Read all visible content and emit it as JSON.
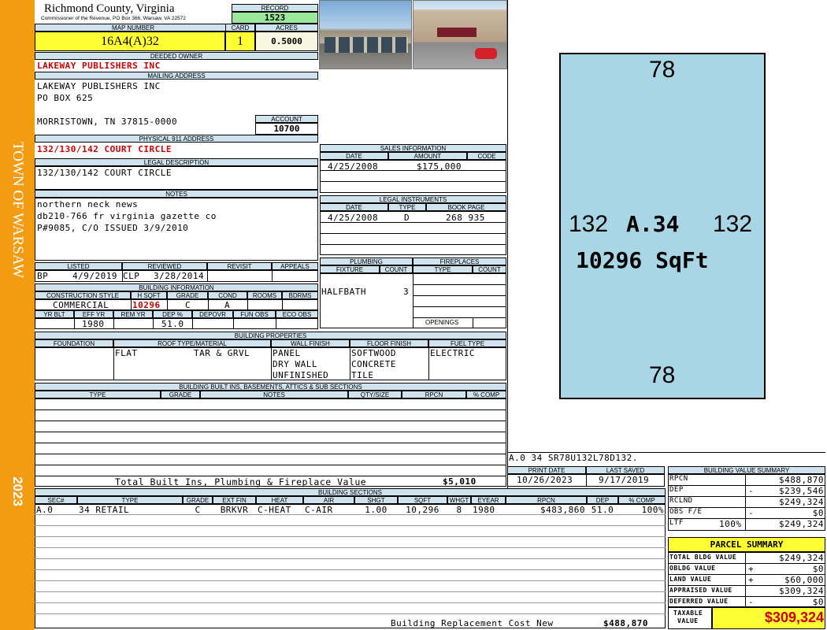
{
  "sidebar": {
    "town": "TOWN OF WARSAW",
    "year": "2023"
  },
  "header": {
    "county": "Richmond County, Virginia",
    "commissioner": "Commissioner of the Revenue, PO Box 366, Warsaw, VA 22572",
    "record_label": "RECORD",
    "record": "1523",
    "map_number_label": "MAP NUMBER",
    "map_number": "16A4(A)32",
    "card_label": "CARD",
    "card": "1",
    "acres_label": "ACRES",
    "acres": "0.5000"
  },
  "owner": {
    "deeded_label": "DEEDED OWNER",
    "deeded_owner": "LAKEWAY PUBLISHERS INC",
    "mailing_label": "MAILING ADDRESS",
    "mail_line1": "LAKEWAY PUBLISHERS INC",
    "mail_line2": "PO BOX 625",
    "mail_line3": "MORRISTOWN, TN 37815-0000",
    "account_label": "ACCOUNT",
    "account": "10700",
    "physical_label": "PHYSICAL 911 ADDRESS",
    "physical": "132/130/142 COURT CIRCLE",
    "legal_label": "LEGAL DESCRIPTION",
    "legal": "132/130/142 COURT CIRCLE",
    "notes_label": "NOTES",
    "note1": "northern neck news",
    "note2": "db210-766 fr virginia gazette co",
    "note3": "P#9085, C/O ISSUED 3/9/2010"
  },
  "sales": {
    "label": "SALES INFORMATION",
    "col_date": "DATE",
    "col_amount": "AMOUNT",
    "col_code": "CODE",
    "date": "4/25/2008",
    "amount": "$175,000",
    "code": ""
  },
  "legal_instruments": {
    "label": "LEGAL INSTRUMENTS",
    "col_date": "DATE",
    "col_type": "TYPE",
    "col_book": "BOOK PAGE",
    "date": "4/25/2008",
    "type": "D",
    "book": "268 935"
  },
  "review": {
    "listed_label": "LISTED",
    "reviewed_label": "REVIEWED",
    "revisit_label": "REVISIT",
    "appeals_label": "APPEALS",
    "listed_by": "BP",
    "listed_date": "4/9/2019",
    "reviewed_by": "CLP",
    "reviewed_date": "3/28/2014"
  },
  "building_info": {
    "label": "BUILDING INFORMATION",
    "col_style": "CONSTRUCTION STYLE",
    "col_hsqft": "H SQFT",
    "col_grade": "GRADE",
    "col_cond": "COND",
    "col_rooms": "ROOMS",
    "col_bdrms": "BDRMS",
    "style": "COMMERCIAL",
    "hsqft": "10296",
    "grade": "C",
    "cond": "A",
    "col_yrblt": "YR BLT",
    "col_effyr": "EFF YR",
    "col_remyr": "REM YR",
    "col_dep": "DEP %",
    "col_depovr": "DEPOVR",
    "col_funobs": "FUN OBS",
    "col_ecoobs": "ECO OBS",
    "effyr": "1980",
    "dep": "51.0"
  },
  "plumbing": {
    "label": "PLUMBING",
    "col_fixture": "FIXTURE",
    "col_count": "COUNT",
    "fixture": "HALFBATH",
    "count": "3"
  },
  "fireplaces": {
    "label": "FIREPLACES",
    "col_type": "TYPE",
    "col_count": "COUNT",
    "openings": "OPENINGS"
  },
  "building_properties": {
    "label": "BUILDING PROPERTIES",
    "col_foundation": "FOUNDATION",
    "col_roof": "ROOF TYPE/MATERIAL",
    "col_wall": "WALL FINISH",
    "col_floor": "FLOOR FINISH",
    "col_fuel": "FUEL TYPE",
    "roof_type": "FLAT",
    "roof_material": "TAR & GRVL",
    "wall1": "PANEL",
    "wall2": "DRY WALL",
    "wall3": "UNFINISHED",
    "floor1": "SOFTWOOD",
    "floor2": "CONCRETE",
    "floor3": "TILE",
    "fuel": "ELECTRIC"
  },
  "built_ins": {
    "label": "BUILDING BUILT INS, BASEMENTS, ATTICS & SUB SECTIONS",
    "col_type": "TYPE",
    "col_grade": "GRADE",
    "col_notes": "NOTES",
    "col_qty": "QTY/SIZE",
    "col_rpcn": "RPCN",
    "col_comp": "% COMP",
    "total_label": "Total Built Ins, Plumbing & Fireplace Value",
    "total": "$5,010"
  },
  "sketch": {
    "top": "78",
    "bottom": "78",
    "left": "132",
    "right": "132",
    "section": "A.34",
    "area": "10296 SqFt",
    "code": "A.0   34   SR78U132L78D132."
  },
  "dates": {
    "print_label": "PRINT DATE",
    "saved_label": "LAST SAVED",
    "print_date": "10/26/2023",
    "saved_date": "9/17/2019"
  },
  "sections": {
    "label": "BUILDING SECTIONS",
    "cols": [
      "SEC#",
      "TYPE",
      "GRADE",
      "EXT FIN",
      "HEAT",
      "AIR",
      "SHGT",
      "SQFT",
      "WHGT",
      "EYEAR",
      "RPCN",
      "DEP",
      "% COMP"
    ],
    "row": [
      "A.0",
      "34 RETAIL",
      "C",
      "BRKVR",
      "C-HEAT",
      "C-AIR",
      "1.00",
      "10,296",
      "8",
      "1980",
      "$483,860",
      "51.0",
      "100%"
    ],
    "total_label": "Building Replacement Cost New",
    "total": "$488,870"
  },
  "value_summary": {
    "label": "BUILDING VALUE SUMMARY",
    "rpcn_label": "RPCN",
    "rpcn": "$488,870",
    "dep_label": "DEP",
    "dep_sign": "-",
    "dep": "$239,546",
    "rclnd_label": "RCLND",
    "rclnd": "$249,324",
    "obs_label": "OBS F/E",
    "obs_sign": "-",
    "obs": "$0",
    "ltf_label": "LTF",
    "ltf_pct": "100%",
    "ltf": "$249,324"
  },
  "parcel_summary": {
    "label": "PARCEL SUMMARY",
    "bldg_label": "TOTAL BLDG VALUE",
    "bldg": "$249,324",
    "obldg_label": "OBLDG VALUE",
    "obldg_sign": "+",
    "obldg": "$0",
    "land_label": "LAND VALUE",
    "land_sign": "+",
    "land": "$60,000",
    "appraised_label": "APPRAISED VALUE",
    "appraised": "$309,324",
    "deferred_label": "DEFERRED VALUE",
    "deferred_sign": "-",
    "deferred": "$0",
    "taxable_label1": "TAXABLE",
    "taxable_label2": "VALUE",
    "taxable": "$309,324"
  },
  "colors": {
    "sidebar": "#f39c12",
    "header_blue": "#cfe3ef",
    "yellow": "#ffff33",
    "green": "#9be89b",
    "sketch_fill": "#a9d6e5",
    "red": "#cc0000"
  }
}
